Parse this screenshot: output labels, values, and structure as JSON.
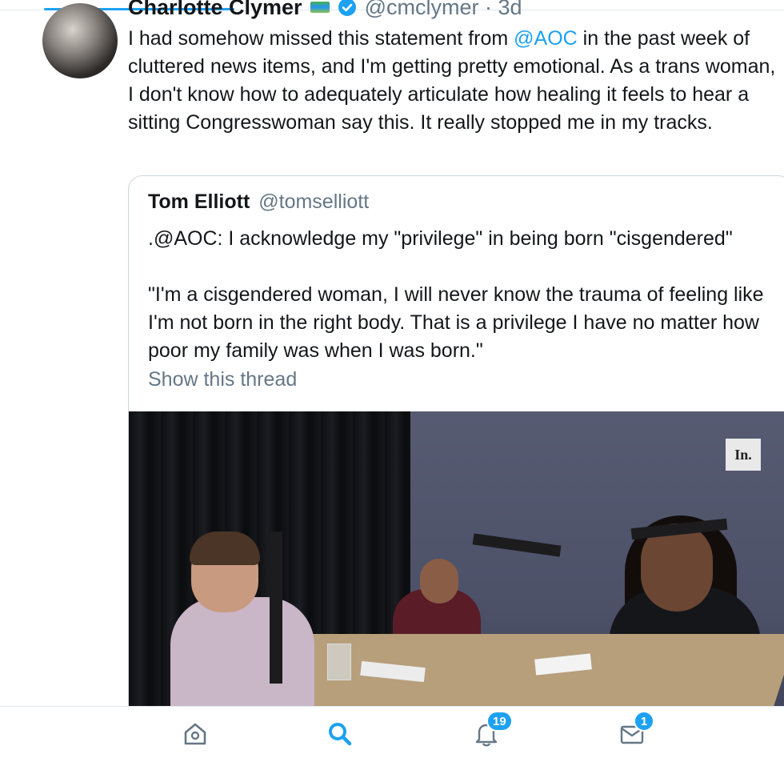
{
  "tweet": {
    "author_name": "Charlotte Clymer",
    "handle": "@cmclymer",
    "time": "· 3d",
    "text_before_mention": "I had somehow missed this statement from ",
    "mention": "@AOC",
    "text_after_mention": " in the past week of cluttered news items, and I'm getting pretty emotional. As a trans woman, I don't know how to adequately articulate how healing it feels to hear a sitting Congresswoman say this. It really stopped me in my tracks."
  },
  "quoted": {
    "author_name": "Tom Elliott",
    "handle": "@tomselliott",
    "line1": ".@AOC: I acknowledge my \"privilege\" in being born \"cisgendered\"",
    "line2": "\"I'm a cisgendered woman, I will never know the trauma of feeling like I'm not born in the right body. That is a privilege I have no matter how poor my family was when I was born.\"",
    "show_thread": "Show this thread",
    "media_logo": "In."
  },
  "tabbar": {
    "home_icon": "home-icon",
    "search_icon": "search-icon",
    "notifications_icon": "bell-icon",
    "notifications_count": "19",
    "messages_icon": "mail-icon",
    "messages_count": "1"
  },
  "colors": {
    "accent": "#1da1f2",
    "text": "#14171a",
    "secondary_text": "#657786",
    "border": "#ccd6dd"
  }
}
